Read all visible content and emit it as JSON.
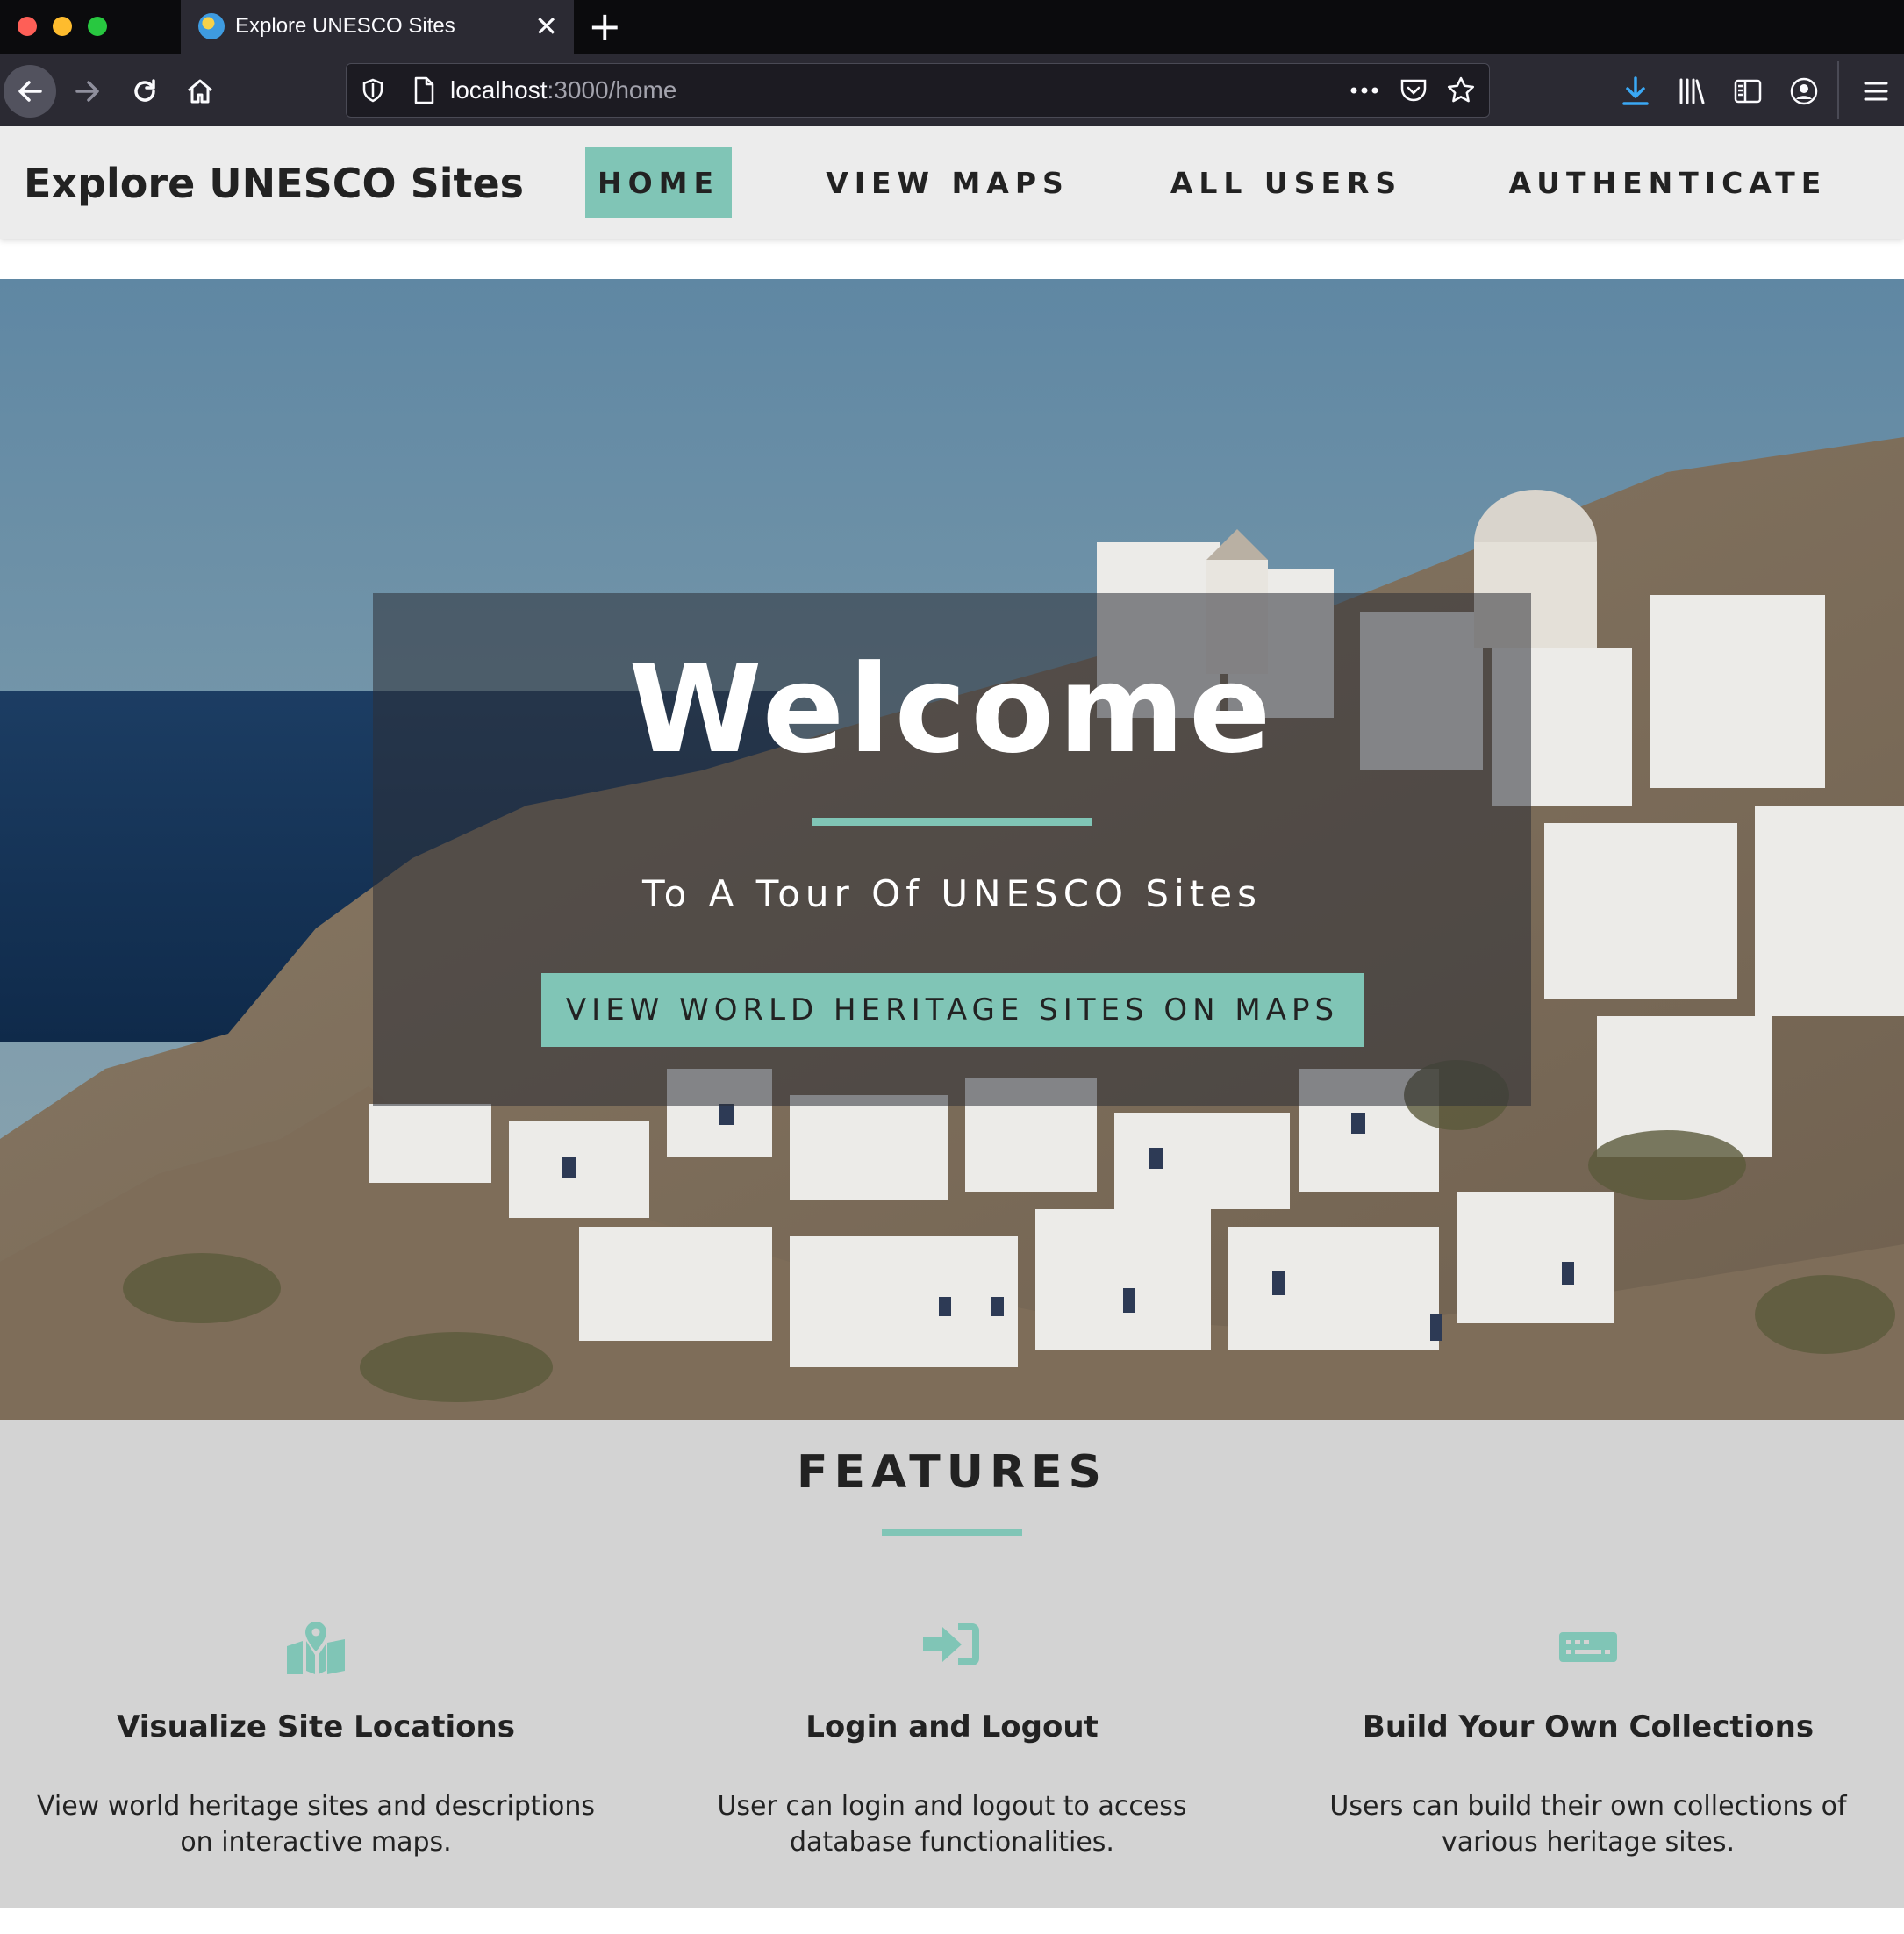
{
  "browser": {
    "tab_title": "Explore UNESCO Sites",
    "url_host": "localhost",
    "url_path": ":3000/home",
    "icons": [
      "back-icon",
      "forward-icon",
      "reload-icon",
      "home-icon",
      "shield-icon",
      "page-icon",
      "more-icon",
      "pocket-icon",
      "star-icon",
      "download-icon",
      "library-icon",
      "sidebar-icon",
      "account-icon",
      "menu-icon"
    ]
  },
  "navbar": {
    "brand": "Explore UNESCO Sites",
    "links": [
      {
        "label": "HOME",
        "active": true
      },
      {
        "label": "VIEW MAPS",
        "active": false
      },
      {
        "label": "ALL USERS",
        "active": false
      },
      {
        "label": "AUTHENTICATE",
        "active": false
      }
    ]
  },
  "hero": {
    "title": "Welcome",
    "subtitle": "To A Tour Of UNESCO Sites",
    "cta_label": "VIEW WORLD HERITAGE SITES ON MAPS"
  },
  "features": {
    "title": "FEATURES",
    "items": [
      {
        "icon": "map-marker-icon",
        "heading": "Visualize Site Locations",
        "text": "View world heritage sites and descriptions on interactive maps."
      },
      {
        "icon": "sign-in-icon",
        "heading": "Login and Logout",
        "text": "User can login and logout to access database functionalities."
      },
      {
        "icon": "keyboard-icon",
        "heading": "Build Your Own Collections",
        "text": "Users can build their own collections of various heritage sites."
      }
    ]
  },
  "colors": {
    "accent": "#80c5b6",
    "navbar_bg": "#ececec",
    "features_bg": "#d3d3d3",
    "chrome_bg": "#2b2a33"
  }
}
